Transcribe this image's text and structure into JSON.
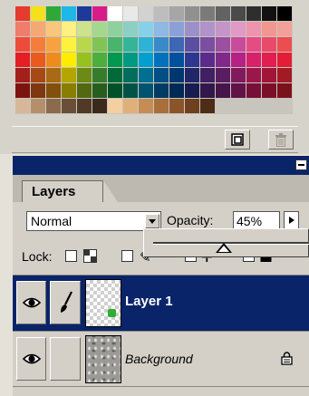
{
  "swatches": {
    "rows": [
      [
        "#e53b2f",
        "#f4e11a",
        "#2fa83a",
        "#1fb6e8",
        "#1d3a9a",
        "#d91c8a",
        "#ffffff",
        "#e9e9e9",
        "#d2d2d2",
        "#bdbdbd",
        "#a6a6a6",
        "#909090",
        "#7a7a7a",
        "#626262",
        "#4a4a4a",
        "#2e2e2e",
        "#111111",
        "#000000"
      ],
      [
        "#f07c6c",
        "#f5a874",
        "#f8c67c",
        "#fff083",
        "#cce28c",
        "#a5d88f",
        "#8fd19d",
        "#8ccfc4",
        "#87d0ea",
        "#8fb8e3",
        "#8ca0d8",
        "#9c90c9",
        "#b192c9",
        "#c594c9",
        "#e19ac6",
        "#ef94ae",
        "#f29690",
        "#f3a09a"
      ],
      [
        "#ee4b3b",
        "#f47d3b",
        "#f8a23f",
        "#fff23f",
        "#b8d84c",
        "#80c554",
        "#49b46b",
        "#34b59a",
        "#2db2d8",
        "#3a8ac9",
        "#3d66b5",
        "#5a4ea2",
        "#7b4ea2",
        "#9c4ea1",
        "#c94b9c",
        "#e64c84",
        "#ea4a6a",
        "#ec4d50"
      ],
      [
        "#e31e24",
        "#e95a1d",
        "#ef8b1c",
        "#ffed00",
        "#96c11f",
        "#4caf3b",
        "#00994f",
        "#009a84",
        "#009fd2",
        "#0072bb",
        "#0050a0",
        "#2e3790",
        "#5b2b8c",
        "#7f2a8a",
        "#b52185",
        "#d9206a",
        "#e21d4f",
        "#e31d36"
      ],
      [
        "#a31f1c",
        "#a54a17",
        "#a86a12",
        "#b4a500",
        "#6b8a16",
        "#367d2b",
        "#006b38",
        "#006d5d",
        "#006f92",
        "#004f83",
        "#003770",
        "#202667",
        "#401f63",
        "#5a1d61",
        "#801a5d",
        "#9a174b",
        "#a11538",
        "#a11a24"
      ],
      [
        "#7d1311",
        "#7e3710",
        "#81500c",
        "#8a7e00",
        "#516910",
        "#275e20",
        "#00512a",
        "#005246",
        "#00546f",
        "#003b63",
        "#002a55",
        "#181c4e",
        "#31174b",
        "#44164a",
        "#621246",
        "#761039",
        "#7b0f2a",
        "#7b121b"
      ],
      [
        "#d7b79a",
        "#b48f6c",
        "#8c6a4d",
        "#6a4e37",
        "#503a27",
        "#3b2a1c",
        "#f4cfa2",
        "#e0b07b",
        "#c58d55",
        "#a96f3a",
        "#8c5529",
        "#6f4020",
        "#4d2d16",
        "#c8c5bc",
        "#c8c5bc",
        "#c8c5bc",
        "#c8c5bc",
        "#c8c5bc"
      ]
    ]
  },
  "layers_panel": {
    "tab_label": "Layers",
    "blend_mode": "Normal",
    "opacity_label": "Opacity:",
    "opacity_value": "45%",
    "opacity_fraction": 0.45,
    "lock_label": "Lock:",
    "layers": [
      {
        "name": "Layer 1",
        "selected": true
      },
      {
        "name": "Background",
        "selected": false
      }
    ]
  },
  "colors": {
    "titlebar": "#0a246a",
    "selected_row": "#0a246a",
    "panel_bg": "#d4d0c8"
  }
}
